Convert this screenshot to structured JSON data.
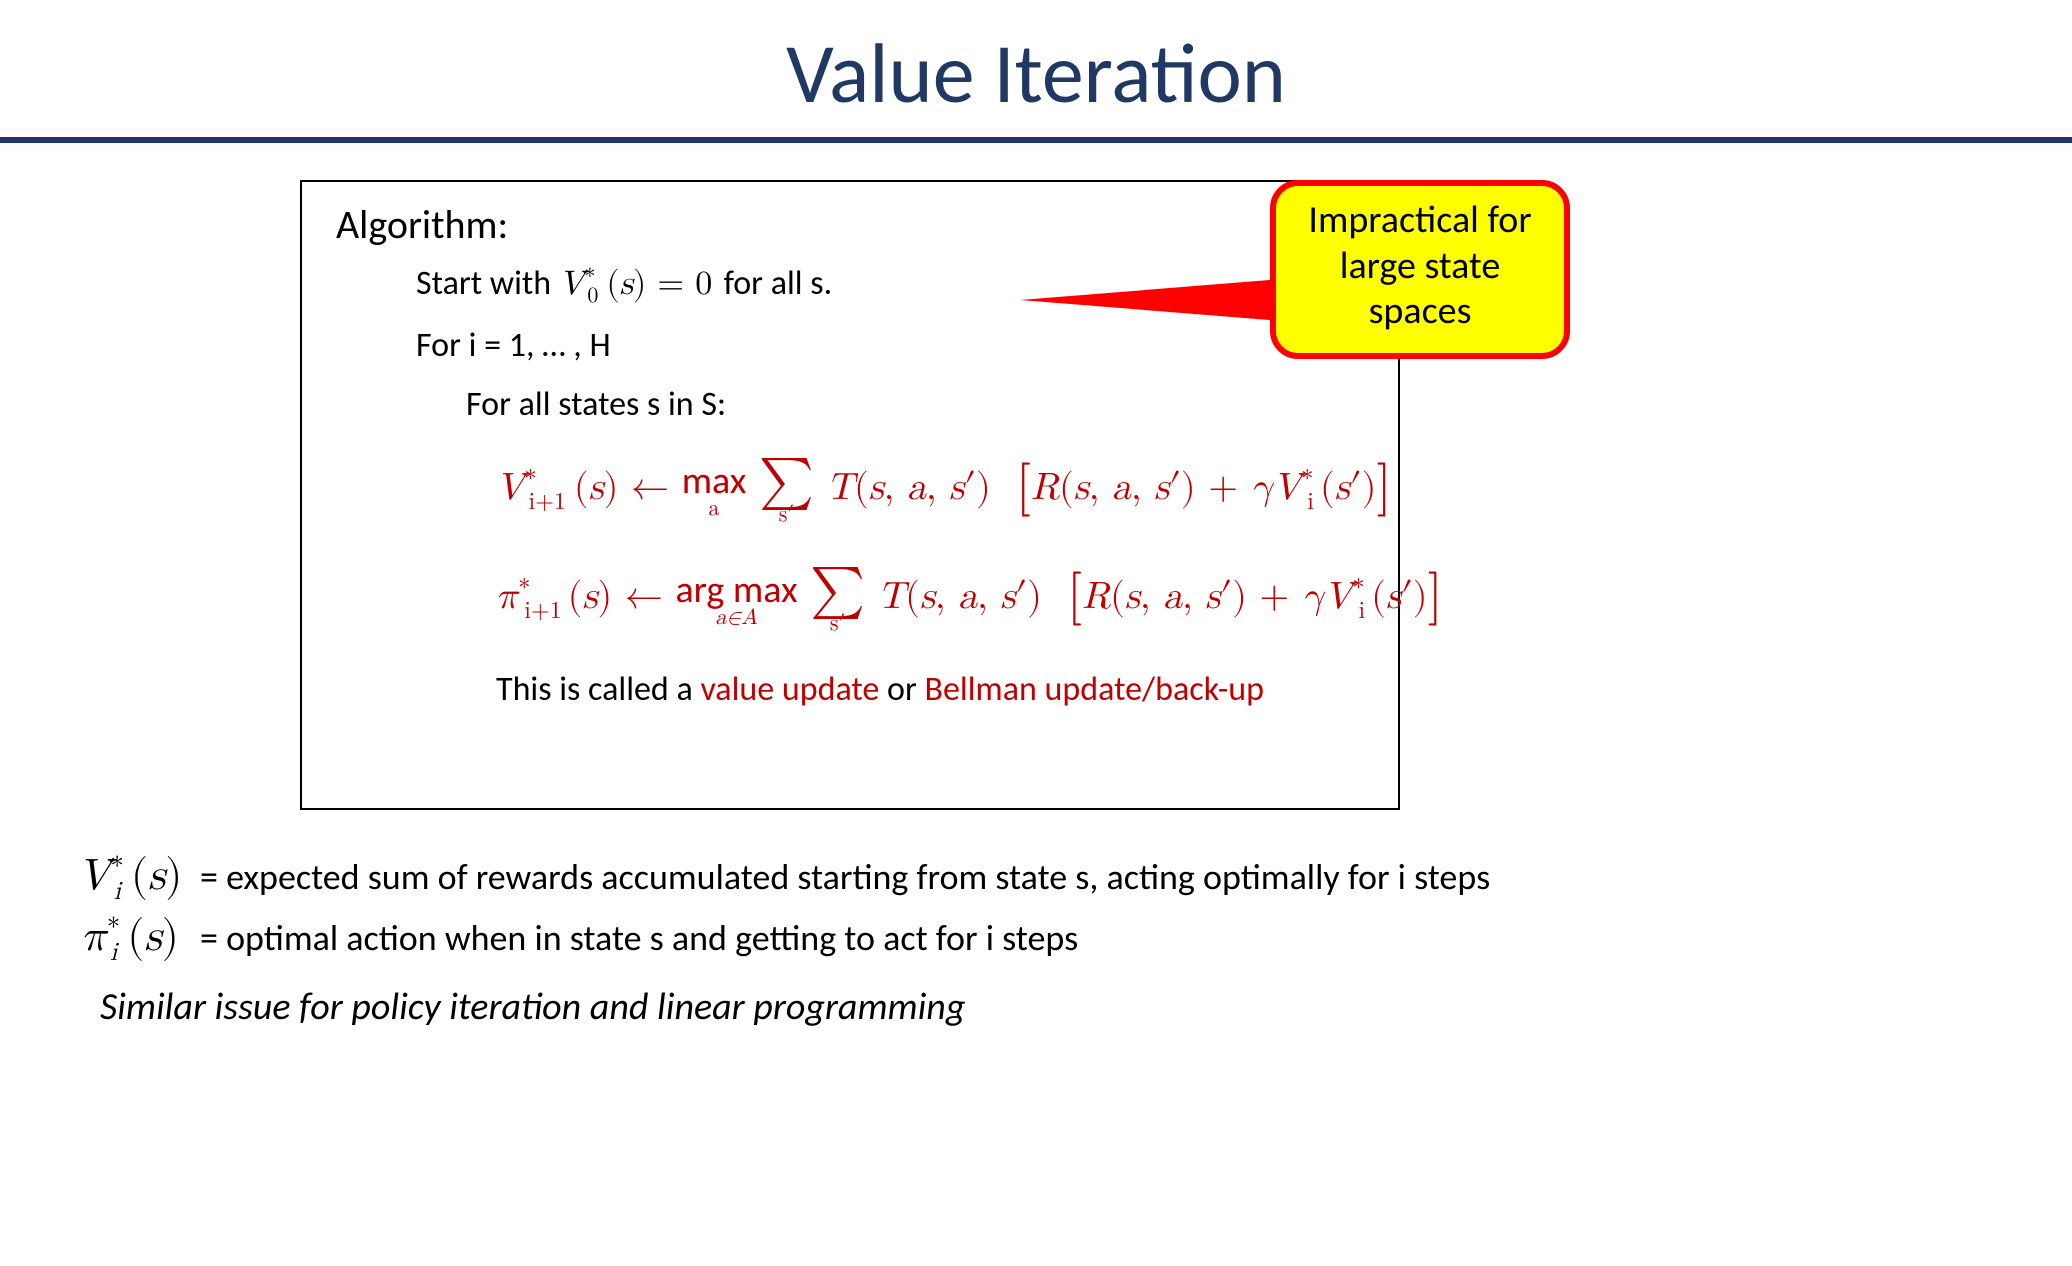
{
  "title": "Value Iteration",
  "algo": {
    "header": "Algorithm:",
    "start_prefix": "Start with ",
    "start_math": "V₀*(s) = 0",
    "start_suffix": "   for all s.",
    "loop": "For i = 1, … , H",
    "inner": "For all states s in S:",
    "v_update_lhs": "V*",
    "v_update_sub": "i+1",
    "v_update_paren": "(s)",
    "arrow": " ← ",
    "max_label": "max",
    "max_sub": "a",
    "argmax_label": "arg max",
    "argmax_sub": "a∈A",
    "sum_symbol": "∑",
    "sum_sub": "s′",
    "T_term": "T(s, a, s′)",
    "R_term": "R(s, a, s′) + γV*",
    "R_sub": "i",
    "R_tail": "(s′)",
    "pi_lhs": "π*",
    "pi_sub": "i+1",
    "note_prefix": "This is called a ",
    "note_red1": "value update",
    "note_mid": " or ",
    "note_red2": "Bellman update/back-up"
  },
  "callout": {
    "line1": "Impractical for",
    "line2": "large state spaces"
  },
  "defs": {
    "v_sym": "V*ᵢ(s)",
    "v_sym_html_main": "V",
    "v_sym_html_sup": "*",
    "v_sym_html_sub": "i",
    "v_sym_html_tail": "(s)",
    "v_text": " = expected sum of rewards accumulated starting from state s, acting optimally for i steps",
    "pi_sym_html_main": "π",
    "pi_text": " = optimal action when in state s and getting to act for i steps",
    "footer": "Similar issue for policy iteration and linear programming"
  }
}
